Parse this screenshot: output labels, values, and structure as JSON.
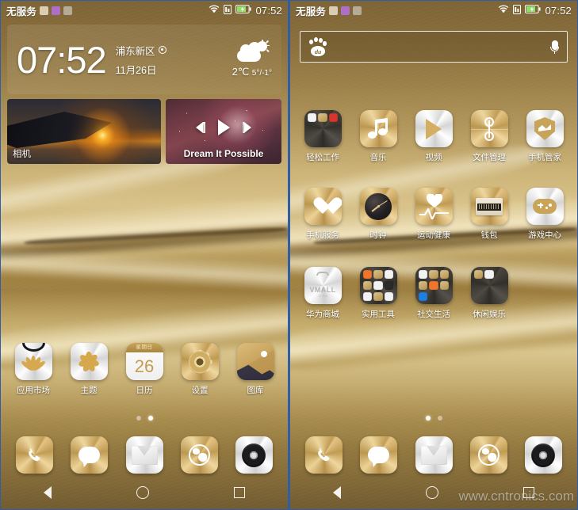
{
  "colors": {
    "accent_gold": "#c9a459",
    "wallpaper_top": "#7d6436",
    "wallpaper_mid": "#d8c289",
    "text_white": "#ffffff",
    "frame_blue": "#2e5ea8"
  },
  "status_bar": {
    "carrier": "无服务",
    "notif_icons": [
      "sim-card-icon",
      "sync-icon",
      "app-notification-icon"
    ],
    "wifi_icon": "wifi-icon",
    "signal_icon": "sim-signal-icon",
    "battery_icon": "battery-charging-icon",
    "clock": "07:52"
  },
  "left_panel": {
    "clock_widget": {
      "time": "07:52",
      "location": "浦东新区",
      "location_icon": "location-pin-icon",
      "date": "11月26日",
      "weather_icon": "partly-cloudy-icon",
      "temp_current": "2℃",
      "temp_range": "5°/-1°"
    },
    "cards": [
      {
        "name": "camera-card",
        "label": "相机",
        "icon": "airplane-sunset-photo"
      },
      {
        "name": "music-card",
        "label": "Dream It Possible",
        "controls": [
          "previous-track-icon",
          "play-icon",
          "next-track-icon"
        ]
      }
    ],
    "apps": [
      {
        "label": "应用市场",
        "icon": "huawei-appgallery-icon",
        "style": "silver"
      },
      {
        "label": "主题",
        "icon": "themes-flower-icon",
        "style": "silver"
      },
      {
        "label": "日历",
        "icon": "calendar-icon",
        "style": "calendar",
        "cal_header": "星期日",
        "cal_day": "26"
      },
      {
        "label": "设置",
        "icon": "settings-gear-icon",
        "style": "gold"
      },
      {
        "label": "图库",
        "icon": "gallery-icon",
        "style": "gallery"
      }
    ],
    "page_dots": {
      "count": 2,
      "active": 1
    }
  },
  "right_panel": {
    "search": {
      "logo_icon": "baidu-paw-icon",
      "logo_text": "du",
      "placeholder": "",
      "value": "",
      "mic_icon": "microphone-icon"
    },
    "apps_rows": [
      [
        {
          "label": "轻松工作",
          "icon": "folder-work-icon",
          "style": "folder-dark-3"
        },
        {
          "label": "音乐",
          "icon": "music-note-icon",
          "style": "gold"
        },
        {
          "label": "视频",
          "icon": "video-play-icon",
          "style": "silver"
        },
        {
          "label": "文件管理",
          "icon": "file-manager-icon",
          "style": "gold"
        },
        {
          "label": "手机管家",
          "icon": "phone-manager-shield-icon",
          "style": "silver"
        }
      ],
      [
        {
          "label": "手机服务",
          "icon": "phone-service-heart-icon",
          "style": "gold"
        },
        {
          "label": "时钟",
          "icon": "clock-icon",
          "style": "gold"
        },
        {
          "label": "运动健康",
          "icon": "health-heartbeat-icon",
          "style": "gold"
        },
        {
          "label": "钱包",
          "icon": "wallet-icon",
          "style": "gold"
        },
        {
          "label": "游戏中心",
          "icon": "game-center-gamepad-icon",
          "style": "silver"
        }
      ],
      [
        {
          "label": "华为商城",
          "icon": "vmall-bag-icon",
          "style": "vmall"
        },
        {
          "label": "实用工具",
          "icon": "folder-tools-icon",
          "style": "folder-dark-9"
        },
        {
          "label": "社交生活",
          "icon": "folder-social-icon",
          "style": "folder-dark-7"
        },
        {
          "label": "休闲娱乐",
          "icon": "folder-leisure-icon",
          "style": "folder-dark-2"
        }
      ]
    ],
    "page_dots": {
      "count": 2,
      "active": 0
    }
  },
  "dock": [
    {
      "label": "phone",
      "icon": "phone-handset-icon",
      "style": "gold"
    },
    {
      "label": "messaging",
      "icon": "message-bubble-icon",
      "style": "gold"
    },
    {
      "label": "email",
      "icon": "envelope-icon",
      "style": "silver"
    },
    {
      "label": "browser",
      "icon": "globe-browser-icon",
      "style": "gold"
    },
    {
      "label": "camera",
      "icon": "camera-lens-icon",
      "style": "silver"
    }
  ],
  "navbar": [
    {
      "name": "back-button",
      "icon": "back-triangle-icon"
    },
    {
      "name": "home-button",
      "icon": "home-circle-icon"
    },
    {
      "name": "recents-button",
      "icon": "recents-square-icon"
    }
  ],
  "watermark": "www.cntronics.com"
}
